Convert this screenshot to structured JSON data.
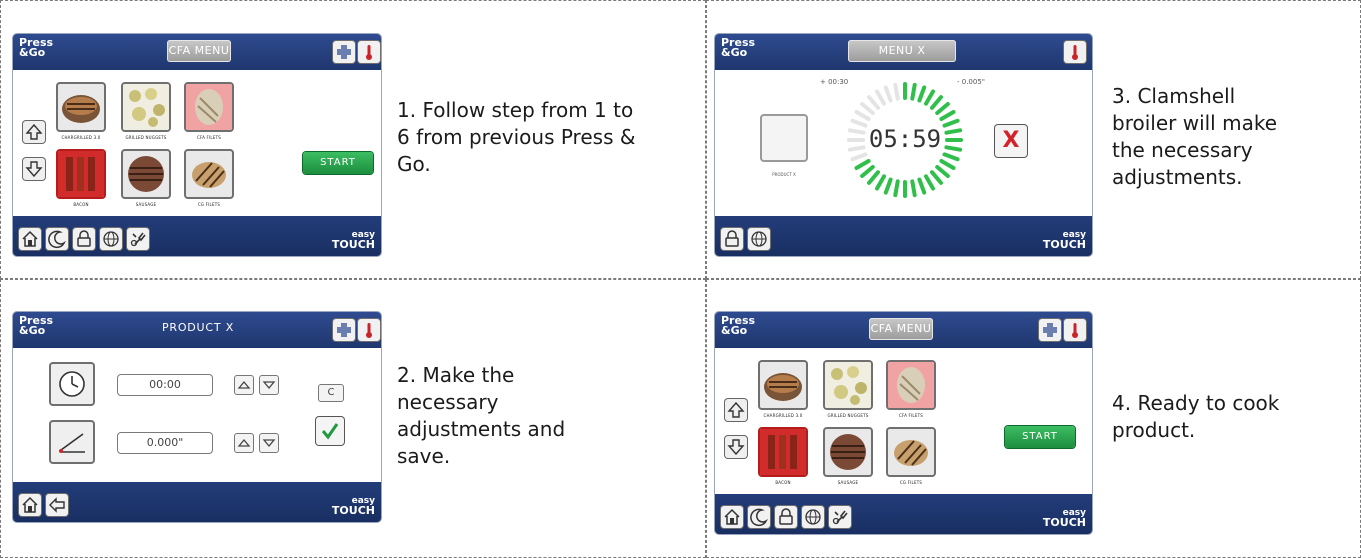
{
  "colors": {
    "header_blue": "#23407e",
    "start_green": "#23a04a",
    "x_red": "#d3232a",
    "check_green": "#1f9a3f",
    "ring_green": "#2fbf4a",
    "panel_border": "#7a7a7a"
  },
  "panels": {
    "p1": {
      "caption": "1.  Follow step from 1 to 6 from previous Press & Go.",
      "logo_top": "Press",
      "logo_bottom": "&Go",
      "menu_label": "CFA MENU",
      "start_label": "START",
      "brand_top": "easy",
      "brand_bottom": "TOUCH",
      "items": [
        "CHARGRILLED 3.0",
        "GRILLED NUGGETS",
        "CFA FILETS",
        "BACON",
        "SAUSAGE",
        "CG FILETS"
      ],
      "icons": [
        "plus-icon",
        "thermometer-icon",
        "arrow-up-icon",
        "arrow-down-icon",
        "home-icon",
        "moon-icon",
        "lock-icon",
        "globe-icon",
        "gear-icon"
      ]
    },
    "p2": {
      "caption": "3.  Clamshell broiler will make the necessary adjustments.",
      "logo_top": "Press",
      "logo_bottom": "&Go",
      "menu_label": "MENU X",
      "time_offset": "+ 00:30",
      "gap_offset": "- 0.005\"",
      "countdown": "05:59",
      "product_label": "PRODUCT X",
      "cancel_label": "X",
      "brand_top": "easy",
      "brand_bottom": "TOUCH"
    },
    "p3": {
      "caption": "2.  Make the necessary adjustments and save.",
      "logo_top": "Press",
      "logo_bottom": "&Go",
      "title": "PRODUCT X",
      "time_value": "00:00",
      "gap_value": "0.000\"",
      "clear_label": "C",
      "brand_top": "easy",
      "brand_bottom": "TOUCH"
    },
    "p4": {
      "caption": "4.  Ready to cook product.",
      "logo_top": "Press",
      "logo_bottom": "&Go",
      "menu_label": "CFA MENU",
      "start_label": "START",
      "brand_top": "easy",
      "brand_bottom": "TOUCH",
      "items": [
        "CHARGRILLED 3.0",
        "GRILLED NUGGETS",
        "CFA FILETS",
        "BACON",
        "SAUSAGE",
        "CG FILETS"
      ]
    }
  }
}
